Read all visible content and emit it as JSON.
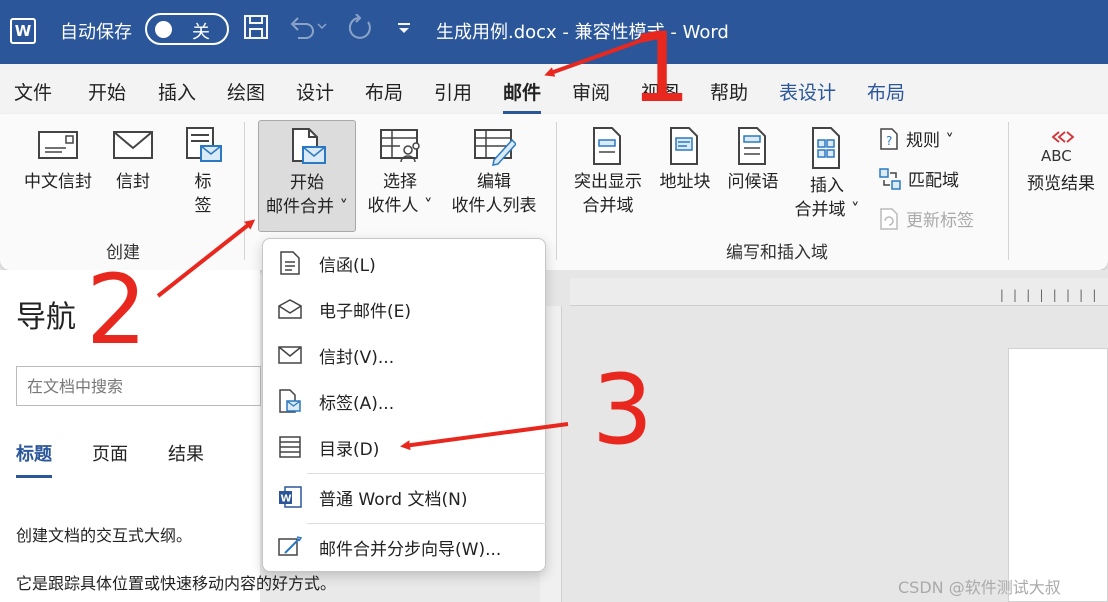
{
  "titlebar": {
    "app_icon": "W",
    "autosave_label": "自动保存",
    "autosave_state": "关",
    "doc_title": "生成用例.docx  -  兼容性模式  -  Word",
    "icons": [
      "save-icon",
      "undo-icon",
      "redo-icon",
      "customize-qat-icon"
    ]
  },
  "menu": {
    "tabs": [
      "文件",
      "开始",
      "插入",
      "绘图",
      "设计",
      "布局",
      "引用",
      "邮件",
      "审阅",
      "视图",
      "帮助",
      "表设计",
      "布局"
    ],
    "active_index": 7
  },
  "ribbon": {
    "create_group": {
      "label": "创建",
      "buttons": [
        "中文信封",
        "信封",
        "标",
        "签"
      ]
    },
    "start_group": {
      "start_line1": "开始",
      "start_line2": "邮件合并 ˅",
      "select_line1": "选择",
      "select_line2": "收件人 ˅",
      "edit_line1": "编辑",
      "edit_line2": "收件人列表"
    },
    "write_group": {
      "label": "编写和插入域",
      "highlight_line1": "突出显示",
      "highlight_line2": "合并域",
      "address_block": "地址块",
      "greeting": "问候语",
      "insert_line1": "插入",
      "insert_line2": "合并域 ˅",
      "rules": "规则 ˅",
      "match_fields": "匹配域",
      "update_labels": "更新标签"
    },
    "preview_group": {
      "icon_text": "ABC",
      "label": "预览结果"
    }
  },
  "dropdown": {
    "items": [
      "信函(L)",
      "电子邮件(E)",
      "信封(V)...",
      "标签(A)...",
      "目录(D)",
      "普通 Word 文档(N)",
      "邮件合并分步向导(W)..."
    ]
  },
  "nav": {
    "title": "导航",
    "search_placeholder": "在文档中搜索",
    "tabs": [
      "标题",
      "页面",
      "结果"
    ],
    "desc1": "创建文档的交互式大纲。",
    "desc2": "它是跟踪具体位置或快速移动内容的好方式。"
  },
  "annotations": [
    "1",
    "2",
    "3"
  ],
  "watermark": "CSDN @软件测试大叔",
  "colors": {
    "word_blue": "#2b579a",
    "annotation_red": "#e8281f"
  }
}
